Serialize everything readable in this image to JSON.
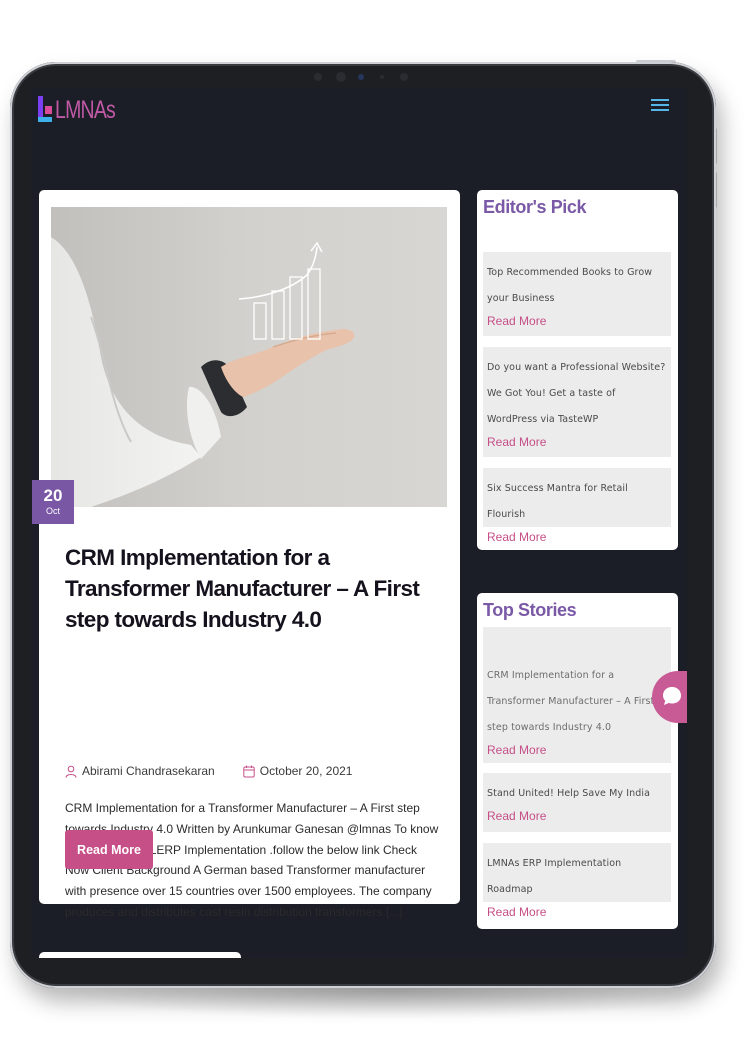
{
  "header": {
    "logo_text": "LMNAs",
    "menu_icon": "hamburger-menu-icon"
  },
  "post": {
    "image_alt": "Hand holding a rising bar chart",
    "date_day": "20",
    "date_month": "Oct",
    "title": "CRM Implementation for a Transformer Manufacturer – A First step towards Industry 4.0",
    "author": "Abirami Chandrasekaran",
    "date": "October 20, 2021",
    "excerpt": "CRM Implementation for a Transformer Manufacturer – A First step towards Industry 4.0 Written by Arunkumar Ganesan  @lmnas To know more about our LERP Implementation .follow the below link Check Now Client Background A German based Transformer manufacturer with presence over 15 countries over 1500 employees. The company produces and distributes cast resin distribution transformers [...]",
    "read_more_label": "Read More"
  },
  "editors_pick": {
    "title": "Editor's Pick",
    "items": [
      {
        "text": "Top Recommended Books to Grow your Business",
        "link": "Read More"
      },
      {
        "text": "Do you want a Professional Website? We Got You! Get a taste of WordPress via TasteWP",
        "link": "Read More"
      },
      {
        "text": "Six Success Mantra for Retail Flourish",
        "link": "Read More"
      }
    ]
  },
  "top_stories": {
    "title": "Top Stories",
    "items": [
      {
        "text": "CRM Implementation for a Transformer Manufacturer – A First step towards Industry 4.0",
        "link": "Read More"
      },
      {
        "text": "Stand United! Help Save My India",
        "link": "Read More"
      },
      {
        "text": "LMNAs ERP Implementation Roadmap",
        "link": "Read More"
      }
    ]
  },
  "colors": {
    "screen_bg": "#1b1d27",
    "accent_pink": "#c64f88",
    "accent_purple": "#7a59a6",
    "menu_blue": "#56b6e8"
  }
}
